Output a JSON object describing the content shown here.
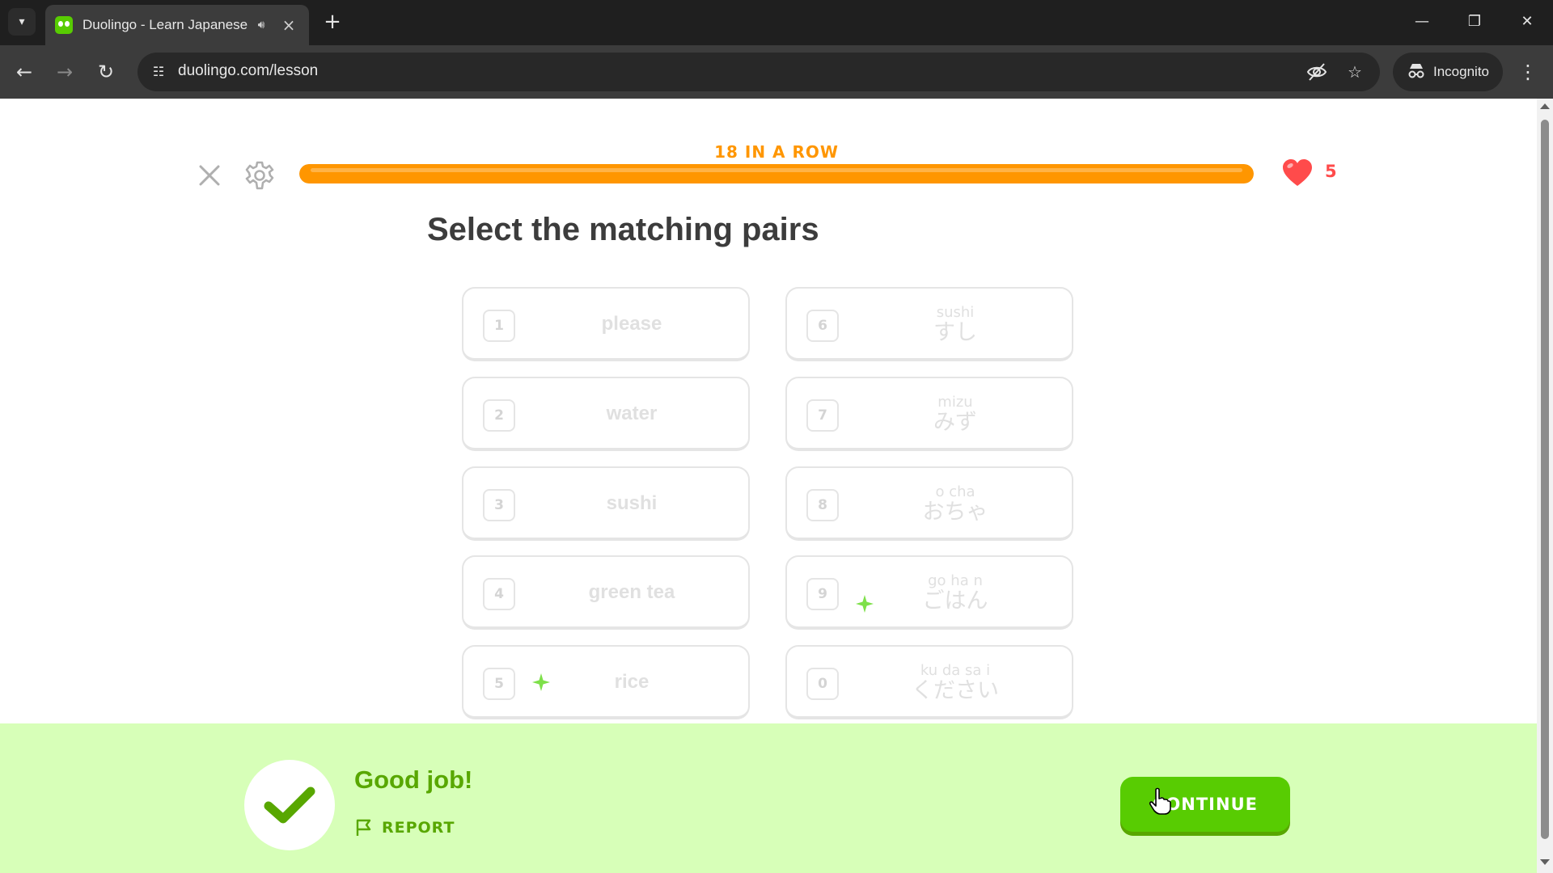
{
  "browser": {
    "tab_title": "Duolingo - Learn Japanese",
    "url": "duolingo.com/lesson",
    "incognito_label": "Incognito"
  },
  "lesson": {
    "streak_text": "18 IN A ROW",
    "progress_fraction": 1.0,
    "hearts": "5",
    "instruction": "Select the matching pairs"
  },
  "left_tiles": [
    {
      "key": "1",
      "text": "please"
    },
    {
      "key": "2",
      "text": "water"
    },
    {
      "key": "3",
      "text": "sushi"
    },
    {
      "key": "4",
      "text": "green tea"
    },
    {
      "key": "5",
      "text": "rice"
    }
  ],
  "right_tiles": [
    {
      "key": "6",
      "romaji": "sushi",
      "kana": "すし"
    },
    {
      "key": "7",
      "romaji": "mizu",
      "kana": "みず"
    },
    {
      "key": "8",
      "romaji": "o cha",
      "kana": "おちゃ"
    },
    {
      "key": "9",
      "romaji": "go ha n",
      "kana": "ごはん"
    },
    {
      "key": "0",
      "romaji": "ku da sa i",
      "kana": "ください"
    }
  ],
  "feedback": {
    "title": "Good job!",
    "report_label": "REPORT",
    "continue_label": "CONTINUE"
  },
  "colors": {
    "brand_green": "#58cc02",
    "streak_orange": "#ff9600",
    "heart_red": "#ff4b4b",
    "feedback_bg": "#d7ffb8"
  }
}
